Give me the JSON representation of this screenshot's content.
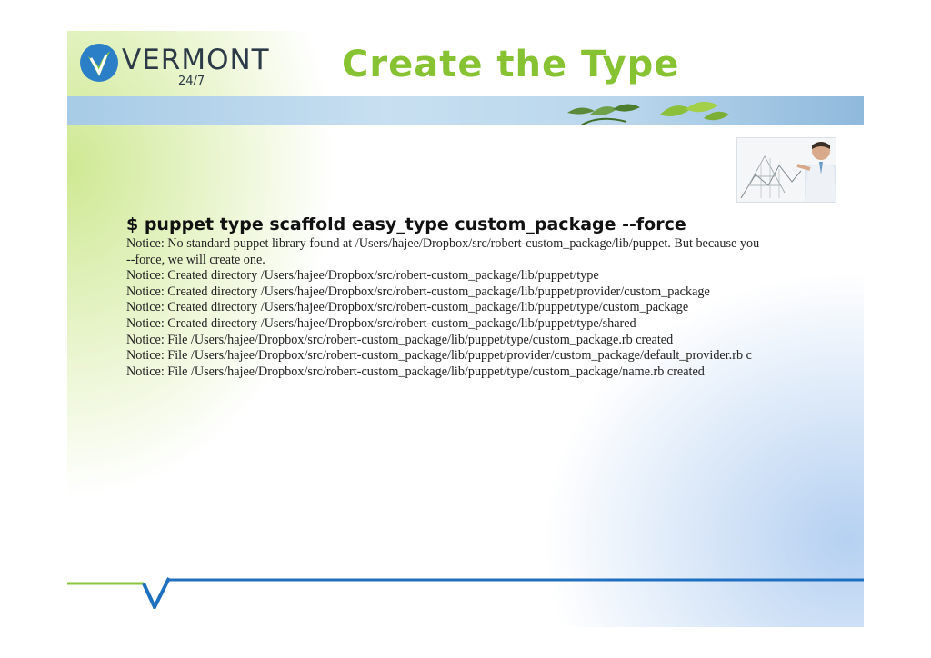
{
  "logo": {
    "name": "VERMONT",
    "tagline": "24/7"
  },
  "title": "Create the Type",
  "command": "$ puppet type scaffold easy_type custom_package --force",
  "output_lines": [
    "Notice: No standard puppet library found at /Users/hajee/Dropbox/src/robert-custom_package/lib/puppet. But because you",
    "--force, we will create one.",
    "Notice: Created directory /Users/hajee/Dropbox/src/robert-custom_package/lib/puppet/type",
    "Notice: Created directory /Users/hajee/Dropbox/src/robert-custom_package/lib/puppet/provider/custom_package",
    "Notice: Created directory /Users/hajee/Dropbox/src/robert-custom_package/lib/puppet/type/custom_package",
    "Notice: Created directory /Users/hajee/Dropbox/src/robert-custom_package/lib/puppet/type/shared",
    "Notice: File /Users/hajee/Dropbox/src/robert-custom_package/lib/puppet/type/custom_package.rb created",
    "Notice: File /Users/hajee/Dropbox/src/robert-custom_package/lib/puppet/provider/custom_package/default_provider.rb c",
    "Notice: File /Users/hajee/Dropbox/src/robert-custom_package/lib/puppet/type/custom_package/name.rb created"
  ],
  "colors": {
    "title_green": "#86c232",
    "footer_blue": "#1f6fc0",
    "logo_dark": "#2b3a46"
  },
  "icons": [
    "vermont-checkmark-logo-icon",
    "leaf-decoration-icon",
    "footer-v-mark-icon"
  ]
}
